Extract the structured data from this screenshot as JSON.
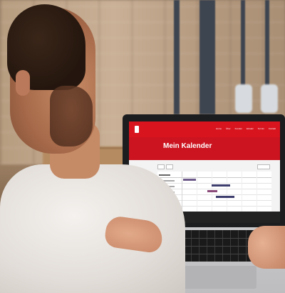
{
  "screen": {
    "title": "Mein Kalender",
    "nav_items": [
      "Home",
      "Über",
      "Kunden",
      "Einsatz",
      "Termin",
      "Kontakt"
    ],
    "accent_color": "#d8141f"
  }
}
